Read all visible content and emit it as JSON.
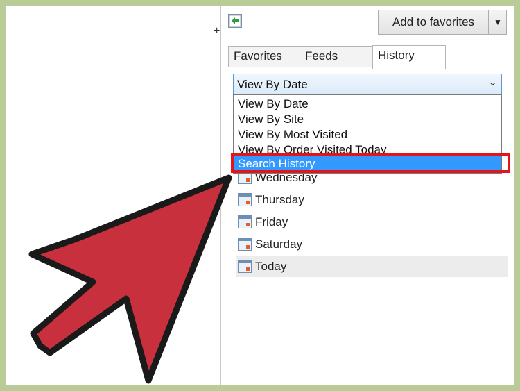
{
  "toolbar": {
    "add_favorites_label": "Add to favorites"
  },
  "tabs": [
    {
      "label": "Favorites",
      "active": false
    },
    {
      "label": "Feeds",
      "active": false
    },
    {
      "label": "History",
      "active": true
    }
  ],
  "view_select": {
    "current": "View By Date",
    "options": [
      "View By Date",
      "View By Site",
      "View By Most Visited",
      "View By Order Visited Today",
      "Search History"
    ],
    "highlighted": "Search History"
  },
  "history_days": [
    "Wednesday",
    "Thursday",
    "Friday",
    "Saturday",
    "Today"
  ],
  "colors": {
    "background_frame": "#b9cc98",
    "highlight_box": "#e3151a",
    "selection": "#3399ff",
    "pointer_arrow": "#c9303d"
  },
  "icons": {
    "back": "green-back-arrow-icon",
    "day": "calendar-icon",
    "dropdown": "chevron-down-icon"
  }
}
